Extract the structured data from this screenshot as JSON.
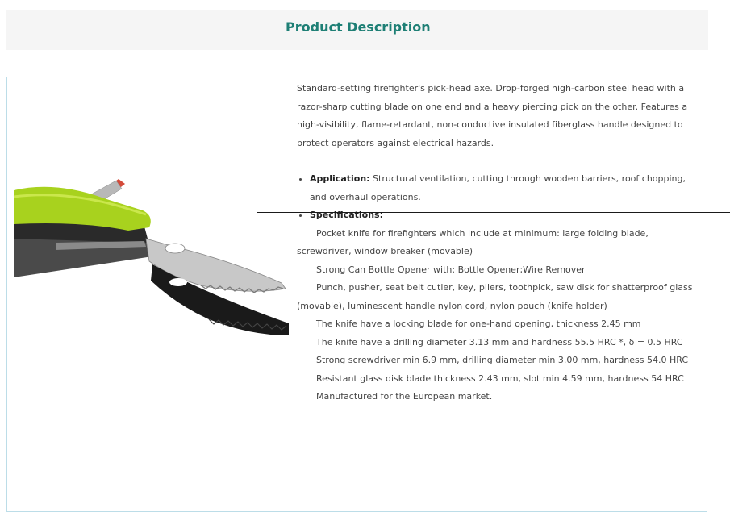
{
  "section": {
    "title": "Product Description"
  },
  "image": {
    "alt": "firefighter pocket knife (green handle, serrated blades)"
  },
  "description": {
    "intro": "Standard-setting firefighter's pick-head axe. Drop-forged high-carbon steel head with a razor-sharp cutting blade on one end and a heavy piercing pick on the other. Features a high-visibility, flame-retardant, non-conductive insulated fiberglass handle designed to protect operators against electrical hazards.",
    "application_label": "Application:",
    "application_text": " Structural ventilation, cutting through wooden barriers, roof chopping, and overhaul operations.",
    "specifications_label": "Specifications:",
    "specs": [
      "Pocket knife for firefighters which include at minimum: large folding blade, screwdriver, window breaker (movable)",
      "Strong Can Bottle Opener with: Bottle Opener;Wire Remover",
      "Punch, pusher, seat belt cutler, key, pliers, toothpick, saw disk for shatterproof glass (movable), luminescent handle nylon cord, nylon pouch (knife holder)",
      "The knife have a locking blade for one-hand opening, thickness 2.45 mm",
      "The knife have a drilling diameter 3.13 mm and hardness 55.5 HRC *, δ = 0.5 HRC",
      "Strong screwdriver min 6.9 mm, drilling diameter min 3.00 mm, hardness 54.0 HRC",
      "Resistant glass disk blade thickness 2.43 mm, slot min 4.59 mm, hardness 54 HRC",
      "Manufactured for the European market."
    ]
  },
  "colors": {
    "title": "#1e7f75",
    "border": "#bcdde8",
    "handle": "#a8d21e"
  }
}
